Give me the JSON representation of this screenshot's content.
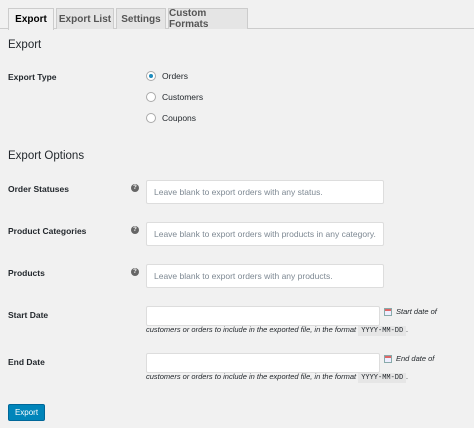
{
  "tabs": [
    {
      "label": "Export"
    },
    {
      "label": "Export List"
    },
    {
      "label": "Settings"
    },
    {
      "label": "Custom Formats"
    }
  ],
  "section_export": "Export",
  "export_type": {
    "label": "Export Type",
    "options": [
      "Orders",
      "Customers",
      "Coupons"
    ],
    "selected": "Orders"
  },
  "section_options": "Export Options",
  "order_statuses": {
    "label": "Order Statuses",
    "placeholder": "Leave blank to export orders with any status."
  },
  "product_categories": {
    "label": "Product Categories",
    "placeholder": "Leave blank to export orders with products in any category."
  },
  "products": {
    "label": "Products",
    "placeholder": "Leave blank to export orders with any products."
  },
  "start_date": {
    "label": "Start Date",
    "desc_a": "Start date of",
    "desc_b": "customers or orders to include in the exported file, in the format",
    "format": "YYYY-MM-DD",
    "desc_end": "."
  },
  "end_date": {
    "label": "End Date",
    "desc_a": "End date of",
    "desc_b": "customers or orders to include in the exported file, in the format",
    "format": "YYYY-MM-DD",
    "desc_end": "."
  },
  "help_glyph": "?",
  "export_button": "Export"
}
